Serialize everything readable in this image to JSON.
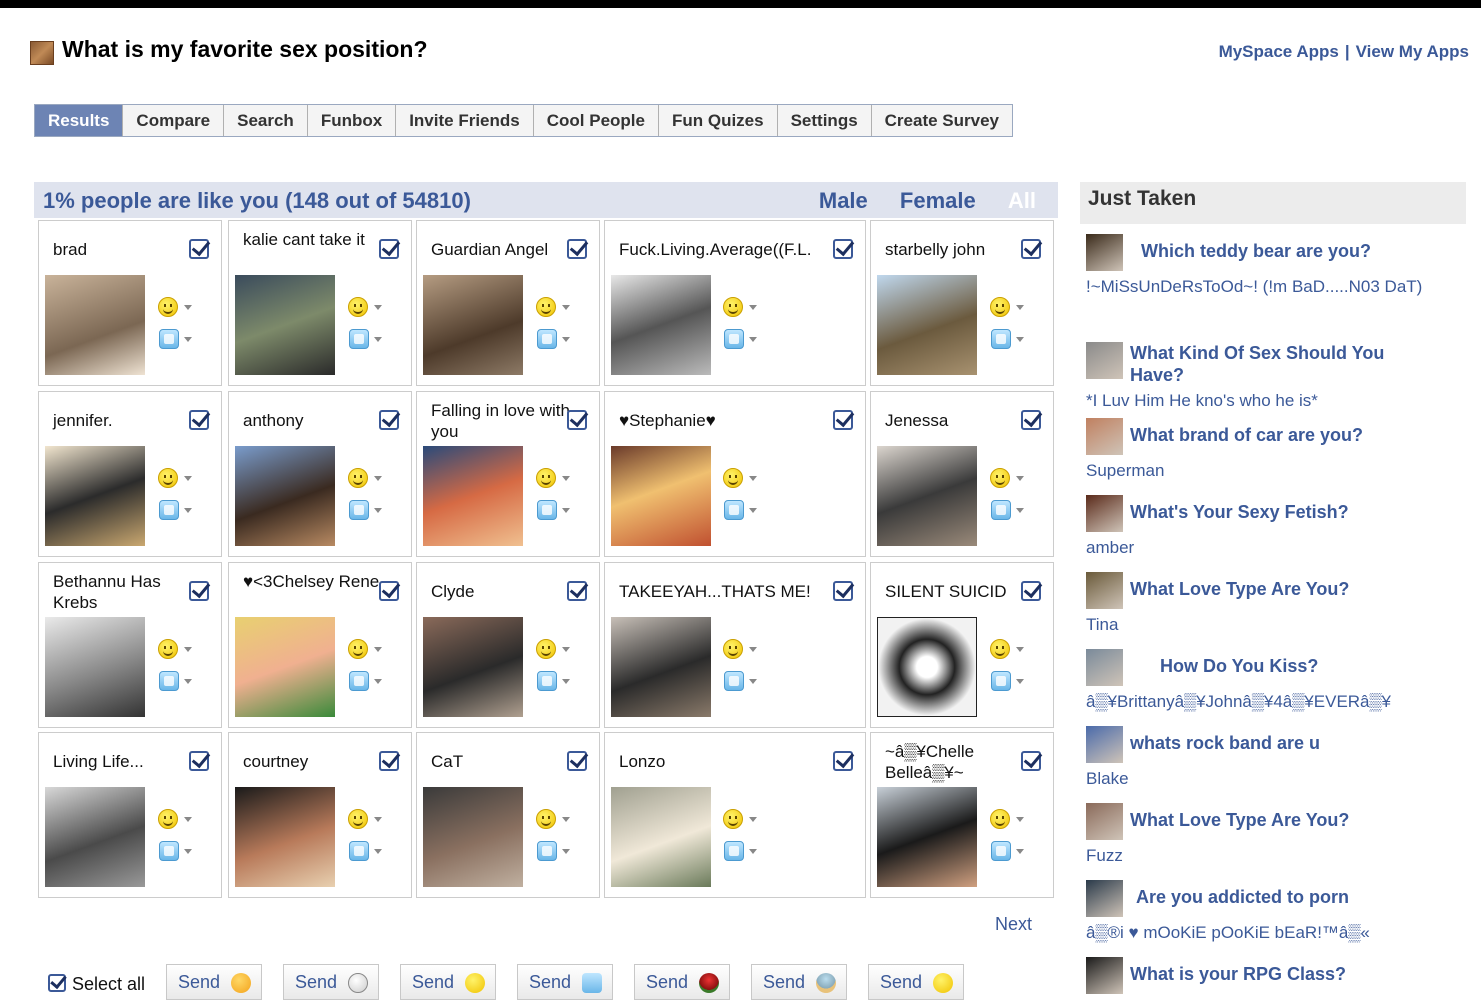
{
  "header": {
    "title": "What is my favorite sex position?",
    "link_apps": "MySpace Apps",
    "link_separator": "|",
    "link_view": "View My Apps"
  },
  "tabs": [
    {
      "label": "Results"
    },
    {
      "label": "Compare"
    },
    {
      "label": "Search"
    },
    {
      "label": "Funbox"
    },
    {
      "label": "Invite Friends"
    },
    {
      "label": "Cool People"
    },
    {
      "label": "Fun Quizes"
    },
    {
      "label": "Settings"
    },
    {
      "label": "Create Survey"
    }
  ],
  "main": {
    "count_text": "1% people are like you (148 out of 54810)",
    "filter_male": "Male",
    "filter_female": "Female",
    "filter_all": "All",
    "next_label": "Next",
    "select_all_label": "Select all",
    "send_label": "Send"
  },
  "people": [
    {
      "name": "brad"
    },
    {
      "name": "kalie cant take it"
    },
    {
      "name": "Guardian Angel"
    },
    {
      "name": "Fuck.Living.Average((F.L."
    },
    {
      "name": "starbelly john"
    },
    {
      "name": "jennifer."
    },
    {
      "name": "anthony"
    },
    {
      "name": "Falling in love with you"
    },
    {
      "name": "♥Stephanie♥"
    },
    {
      "name": "Jenessa"
    },
    {
      "name": "Bethannu Has Krebs"
    },
    {
      "name": "♥<3Chelsey Rene"
    },
    {
      "name": "Clyde"
    },
    {
      "name": "TAKEEYAH...THATS ME!"
    },
    {
      "name": "SILENT SUICID"
    },
    {
      "name": "Living Life..."
    },
    {
      "name": "courtney"
    },
    {
      "name": "CaT"
    },
    {
      "name": "Lonzo"
    },
    {
      "name": "~â▒¥Chelle Belleâ▒¥~"
    }
  ],
  "sidebar": {
    "title": "Just Taken",
    "items": [
      {
        "quiz": "Which teddy bear are you?",
        "user": "!~MiSsUnDeRsToOd~! (!m BaD.....N03 DaT)"
      },
      {
        "quiz": "What Kind Of Sex Should You Have?",
        "user": "*I Luv Him He kno's who he is*"
      },
      {
        "quiz": "What brand of car are you?",
        "user": "Superman"
      },
      {
        "quiz": "What's Your Sexy Fetish?",
        "user": "amber"
      },
      {
        "quiz": "What Love Type Are You?",
        "user": "Tina"
      },
      {
        "quiz": "How Do You Kiss?",
        "user": "â▒¥Brittanyâ▒¥Johnâ▒¥4â▒¥EVERâ▒¥"
      },
      {
        "quiz": "whats rock band are u",
        "user": "Blake"
      },
      {
        "quiz": "What Love Type Are You?",
        "user": "Fuzz"
      },
      {
        "quiz": "Are you addicted to porn",
        "user": "â▒®i ♥ mOoKiE pOoKiE bEaR!™â▒«"
      },
      {
        "quiz": "What is your RPG Class?",
        "user": ""
      }
    ]
  },
  "colors": {
    "link": "#3b5998",
    "tab_active": "#6d84b4",
    "panel_header": "#dfe3ee"
  }
}
